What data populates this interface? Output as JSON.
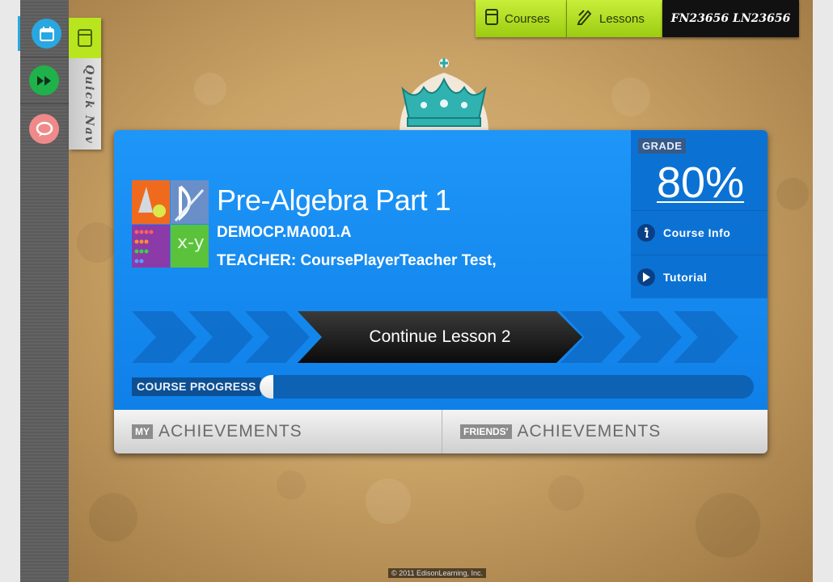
{
  "top_nav": {
    "courses_label": "Courses",
    "lessons_label": "Lessons",
    "user_name": "FN23656 LN23656"
  },
  "left_nav": {
    "items": [
      {
        "icon": "calendar-icon",
        "color": "#29a7e1"
      },
      {
        "icon": "forward-icon",
        "color": "#1fb24b"
      },
      {
        "icon": "chat-bubble-icon",
        "color": "#f08a8a"
      }
    ]
  },
  "quick_nav": {
    "label": "Quick Nav"
  },
  "course": {
    "title": "Pre-Algebra Part 1",
    "code": "DEMOCP.MA001.A",
    "teacher": "TEACHER: CoursePlayerTeacher Test,",
    "grade_label": "GRADE",
    "grade_value": "80%",
    "course_info_label": "Course Info",
    "tutorial_label": "Tutorial",
    "continue_label": "Continue Lesson 2",
    "progress_label": "COURSE PROGRESS",
    "progress_fraction": 0.028
  },
  "achievements": {
    "my_tag": "MY",
    "my_label": "ACHIEVEMENTS",
    "friends_tag": "FRIENDS'",
    "friends_label": "ACHIEVEMENTS"
  },
  "footer": {
    "copyright": "© 2011 EdisonLearning, Inc."
  },
  "colors": {
    "accent_green": "#b9e51f",
    "card_blue": "#1a8ef0",
    "dark_blue": "#0b72d4"
  }
}
